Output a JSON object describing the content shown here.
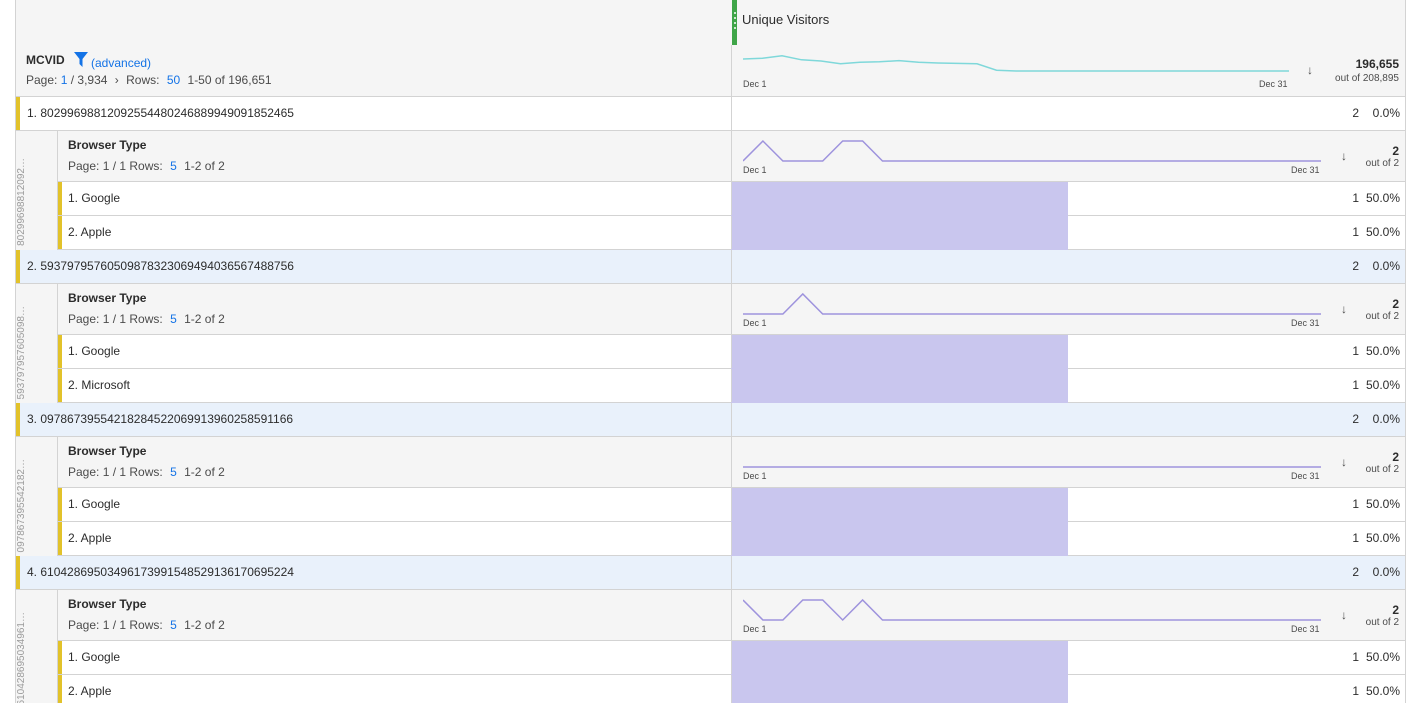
{
  "column": {
    "metric_name": "Unique Visitors",
    "grip_color": "#3fa548"
  },
  "dimension": {
    "name": "MCVID",
    "filter_label": "(advanced)",
    "page_label": "Page:",
    "page_current": "1",
    "page_total": "/ 3,934",
    "rows_label": "Rows:",
    "rows_value": "50",
    "range": "1-50 of 196,651",
    "total_value": "196,655",
    "total_sub": "out of 208,895",
    "spark_start": "Dec 1",
    "spark_end": "Dec 31",
    "spark_color": "#7fd8da",
    "spark_values": [
      1.0,
      1.02,
      1.08,
      0.98,
      0.95,
      0.88,
      0.92,
      0.93,
      0.96,
      0.92,
      0.9,
      0.89,
      0.88,
      0.72,
      0.7,
      0.7,
      0.7,
      0.7,
      0.7,
      0.7,
      0.7,
      0.7,
      0.7,
      0.7,
      0.7,
      0.7,
      0.7,
      0.7,
      0.7
    ]
  },
  "items": [
    {
      "label": "1.  802996988120925544802468899490918524 65",
      "label_full": "1.  80299698812092554480246889949091852465",
      "value": "2",
      "pct": "0.0%",
      "sidebar_text": "80299698812092…",
      "sub": {
        "name": "Browser Type",
        "pager": "Page: 1 / 1  Rows:",
        "rows": "5",
        "range": "1-2 of 2",
        "total": "2",
        "total_sub": "out of 2",
        "spark_start": "Dec 1",
        "spark_end": "Dec 31",
        "spark_values": [
          1,
          2,
          1,
          1,
          1,
          2,
          2,
          1,
          1,
          1,
          1,
          1,
          1,
          1,
          1,
          1,
          1,
          1,
          1,
          1,
          1,
          1,
          1,
          1,
          1,
          1,
          1,
          1,
          1,
          1
        ],
        "rows_list": [
          {
            "label": "1.  Google",
            "value": "1",
            "pct": "50.0%",
            "share": 0.5
          },
          {
            "label": "2.  Apple",
            "value": "1",
            "pct": "50.0%",
            "share": 0.5
          }
        ]
      }
    },
    {
      "label_full": "2.  59379795760509878323069494036567488756",
      "value": "2",
      "pct": "0.0%",
      "sidebar_text": "593797957605098…",
      "sub": {
        "name": "Browser Type",
        "pager": "Page: 1 / 1  Rows:",
        "rows": "5",
        "range": "1-2 of 2",
        "total": "2",
        "total_sub": "out of 2",
        "spark_start": "Dec 1",
        "spark_end": "Dec 31",
        "spark_values": [
          1,
          1,
          1,
          2,
          1,
          1,
          1,
          1,
          1,
          1,
          1,
          1,
          1,
          1,
          1,
          1,
          1,
          1,
          1,
          1,
          1,
          1,
          1,
          1,
          1,
          1,
          1,
          1,
          1,
          1
        ],
        "rows_list": [
          {
            "label": "1.  Google",
            "value": "1",
            "pct": "50.0%",
            "share": 0.5
          },
          {
            "label": "2.  Microsoft",
            "value": "1",
            "pct": "50.0%",
            "share": 0.5
          }
        ]
      }
    },
    {
      "label_full": "3.  09786739554218284522069913960258591166",
      "value": "2",
      "pct": "0.0%",
      "sidebar_text": "097867395542182…",
      "sub": {
        "name": "Browser Type",
        "pager": "Page: 1 / 1  Rows:",
        "rows": "5",
        "range": "1-2 of 2",
        "total": "2",
        "total_sub": "out of 2",
        "spark_start": "Dec 1",
        "spark_end": "Dec 31",
        "spark_values": [
          1,
          1,
          1,
          1,
          1,
          1,
          1,
          1,
          1,
          1,
          1,
          1,
          1,
          1,
          1,
          1,
          1,
          1,
          1,
          1,
          1,
          1,
          1,
          1,
          1,
          1,
          1,
          1,
          1,
          1
        ],
        "rows_list": [
          {
            "label": "1.  Google",
            "value": "1",
            "pct": "50.0%",
            "share": 0.5
          },
          {
            "label": "2.  Apple",
            "value": "1",
            "pct": "50.0%",
            "share": 0.5
          }
        ]
      }
    },
    {
      "label_full": "4.  61042869503496173991548529136170695224",
      "value": "2",
      "pct": "0.0%",
      "sidebar_text": "610428695034961…",
      "sub": {
        "name": "Browser Type",
        "pager": "Page: 1 / 1  Rows:",
        "rows": "5",
        "range": "1-2 of 2",
        "total": "2",
        "total_sub": "out of 2",
        "spark_start": "Dec 1",
        "spark_end": "Dec 31",
        "spark_values": [
          2,
          1,
          1,
          2,
          2,
          1,
          2,
          1,
          1,
          1,
          1,
          1,
          1,
          1,
          1,
          1,
          1,
          1,
          1,
          1,
          1,
          1,
          1,
          1,
          1,
          1,
          1,
          1,
          1,
          1
        ],
        "rows_list": [
          {
            "label": "1.  Google",
            "value": "1",
            "pct": "50.0%",
            "share": 0.5
          },
          {
            "label": "2.  Apple",
            "value": "1",
            "pct": "50.0%",
            "share": 0.5
          }
        ]
      }
    }
  ],
  "colors": {
    "accent": "#e2c22a",
    "bar": "#c9c6ee",
    "sub_spark": "#9e93dd",
    "link": "#1473e6"
  }
}
